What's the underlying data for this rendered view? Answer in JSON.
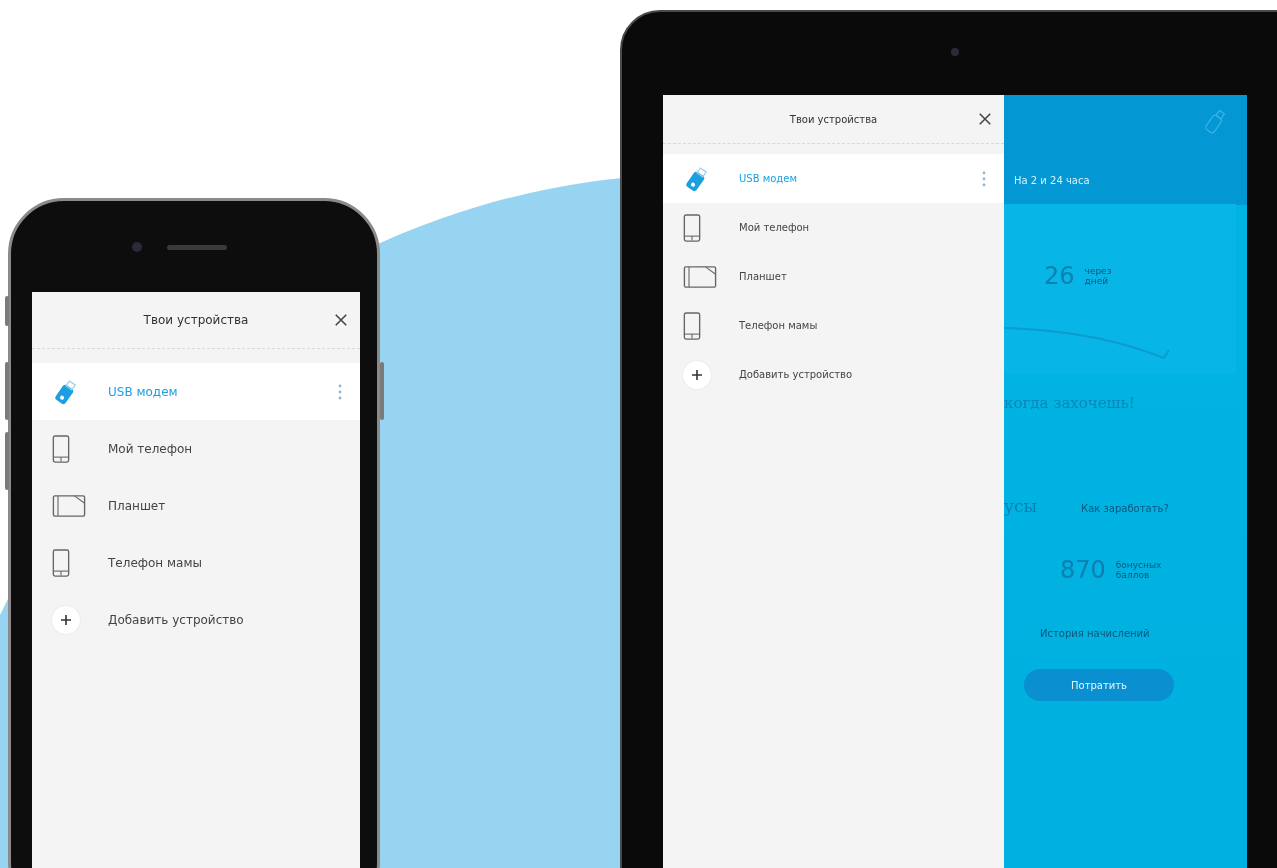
{
  "phone": {
    "panel": {
      "title": "Твои устройства",
      "devices": [
        {
          "kind": "usb",
          "label": "USB модем",
          "selected": true
        },
        {
          "kind": "phone",
          "label": "Мой телефон",
          "selected": false
        },
        {
          "kind": "tablet",
          "label": "Планшет",
          "selected": false
        },
        {
          "kind": "phone",
          "label": "Телефон мамы",
          "selected": false
        }
      ],
      "add_label": "Добавить устройство"
    }
  },
  "tablet": {
    "panel": {
      "title": "Твои устройства",
      "devices": [
        {
          "kind": "usb",
          "label": "USB модем",
          "selected": true
        },
        {
          "kind": "phone",
          "label": "Мой телефон",
          "selected": false
        },
        {
          "kind": "tablet",
          "label": "Планшет",
          "selected": false
        },
        {
          "kind": "phone",
          "label": "Телефон мамы",
          "selected": false
        }
      ],
      "add_label": "Добавить устройство"
    },
    "background_screen": {
      "period": "На 2 и 24 часа",
      "days_value": "26",
      "days_caption": [
        "через",
        "дней"
      ],
      "headline": "когда захочешь!",
      "bonus_heading": "усы",
      "earn_link": "Как заработать?",
      "points_value": "870",
      "points_caption": [
        "бонусных",
        "баллов"
      ],
      "history_link": "История начислений",
      "spend_button": "Потратить"
    }
  }
}
